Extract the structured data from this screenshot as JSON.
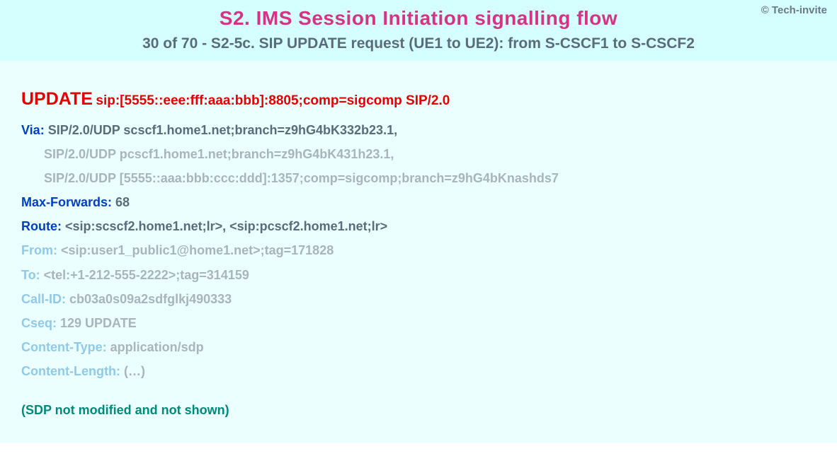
{
  "copyright": "© Tech-invite",
  "title": "S2. IMS Session Initiation signalling flow",
  "subtitle": "30 of 70 - S2-5c. SIP UPDATE request (UE1 to UE2): from S-CSCF1 to S-CSCF2",
  "sip": {
    "method": "UPDATE",
    "request_uri": "sip:[5555::eee:fff:aaa:bbb]:8805;comp=sigcomp SIP/2.0",
    "via": {
      "label": "Via",
      "v1": "SIP/2.0/UDP scscf1.home1.net;branch=z9hG4bK332b23.1,",
      "v2": "SIP/2.0/UDP pcscf1.home1.net;branch=z9hG4bK431h23.1,",
      "v3": "SIP/2.0/UDP [5555::aaa:bbb:ccc:ddd]:1357;comp=sigcomp;branch=z9hG4bKnashds7"
    },
    "max_forwards": {
      "label": "Max-Forwards",
      "value": "68"
    },
    "route": {
      "label": "Route",
      "value": "<sip:scscf2.home1.net;lr>, <sip:pcscf2.home1.net;lr>"
    },
    "from": {
      "label": "From",
      "value": "<sip:user1_public1@home1.net>;tag=171828"
    },
    "to": {
      "label": "To",
      "value": "<tel:+1-212-555-2222>;tag=314159"
    },
    "call_id": {
      "label": "Call-ID",
      "value": "cb03a0s09a2sdfglkj490333"
    },
    "cseq": {
      "label": "Cseq",
      "value": "129 UPDATE"
    },
    "content_type": {
      "label": "Content-Type",
      "value": "application/sdp"
    },
    "content_length": {
      "label": "Content-Length",
      "value": "(…)"
    }
  },
  "footer_note": "(SDP not modified and not shown)"
}
